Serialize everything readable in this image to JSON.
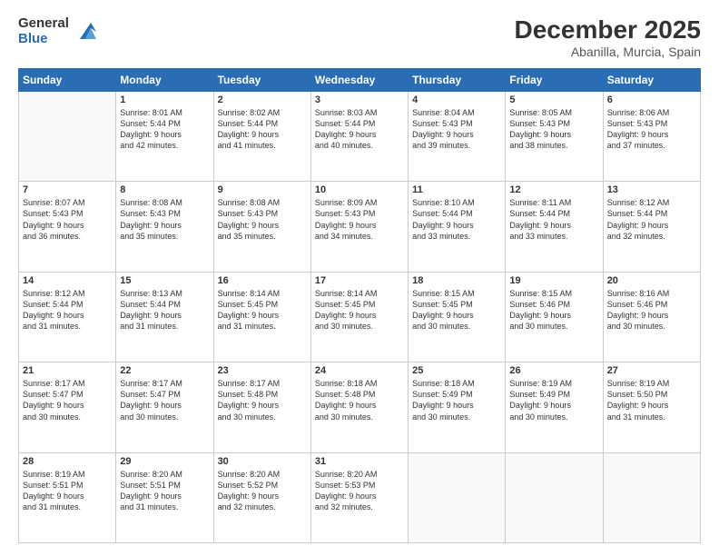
{
  "header": {
    "logo_general": "General",
    "logo_blue": "Blue",
    "month": "December 2025",
    "location": "Abanilla, Murcia, Spain"
  },
  "days_of_week": [
    "Sunday",
    "Monday",
    "Tuesday",
    "Wednesday",
    "Thursday",
    "Friday",
    "Saturday"
  ],
  "weeks": [
    [
      {
        "day": "",
        "info": ""
      },
      {
        "day": "1",
        "info": "Sunrise: 8:01 AM\nSunset: 5:44 PM\nDaylight: 9 hours\nand 42 minutes."
      },
      {
        "day": "2",
        "info": "Sunrise: 8:02 AM\nSunset: 5:44 PM\nDaylight: 9 hours\nand 41 minutes."
      },
      {
        "day": "3",
        "info": "Sunrise: 8:03 AM\nSunset: 5:44 PM\nDaylight: 9 hours\nand 40 minutes."
      },
      {
        "day": "4",
        "info": "Sunrise: 8:04 AM\nSunset: 5:43 PM\nDaylight: 9 hours\nand 39 minutes."
      },
      {
        "day": "5",
        "info": "Sunrise: 8:05 AM\nSunset: 5:43 PM\nDaylight: 9 hours\nand 38 minutes."
      },
      {
        "day": "6",
        "info": "Sunrise: 8:06 AM\nSunset: 5:43 PM\nDaylight: 9 hours\nand 37 minutes."
      }
    ],
    [
      {
        "day": "7",
        "info": "Sunrise: 8:07 AM\nSunset: 5:43 PM\nDaylight: 9 hours\nand 36 minutes."
      },
      {
        "day": "8",
        "info": "Sunrise: 8:08 AM\nSunset: 5:43 PM\nDaylight: 9 hours\nand 35 minutes."
      },
      {
        "day": "9",
        "info": "Sunrise: 8:08 AM\nSunset: 5:43 PM\nDaylight: 9 hours\nand 35 minutes."
      },
      {
        "day": "10",
        "info": "Sunrise: 8:09 AM\nSunset: 5:43 PM\nDaylight: 9 hours\nand 34 minutes."
      },
      {
        "day": "11",
        "info": "Sunrise: 8:10 AM\nSunset: 5:44 PM\nDaylight: 9 hours\nand 33 minutes."
      },
      {
        "day": "12",
        "info": "Sunrise: 8:11 AM\nSunset: 5:44 PM\nDaylight: 9 hours\nand 33 minutes."
      },
      {
        "day": "13",
        "info": "Sunrise: 8:12 AM\nSunset: 5:44 PM\nDaylight: 9 hours\nand 32 minutes."
      }
    ],
    [
      {
        "day": "14",
        "info": "Sunrise: 8:12 AM\nSunset: 5:44 PM\nDaylight: 9 hours\nand 31 minutes."
      },
      {
        "day": "15",
        "info": "Sunrise: 8:13 AM\nSunset: 5:44 PM\nDaylight: 9 hours\nand 31 minutes."
      },
      {
        "day": "16",
        "info": "Sunrise: 8:14 AM\nSunset: 5:45 PM\nDaylight: 9 hours\nand 31 minutes."
      },
      {
        "day": "17",
        "info": "Sunrise: 8:14 AM\nSunset: 5:45 PM\nDaylight: 9 hours\nand 30 minutes."
      },
      {
        "day": "18",
        "info": "Sunrise: 8:15 AM\nSunset: 5:45 PM\nDaylight: 9 hours\nand 30 minutes."
      },
      {
        "day": "19",
        "info": "Sunrise: 8:15 AM\nSunset: 5:46 PM\nDaylight: 9 hours\nand 30 minutes."
      },
      {
        "day": "20",
        "info": "Sunrise: 8:16 AM\nSunset: 5:46 PM\nDaylight: 9 hours\nand 30 minutes."
      }
    ],
    [
      {
        "day": "21",
        "info": "Sunrise: 8:17 AM\nSunset: 5:47 PM\nDaylight: 9 hours\nand 30 minutes."
      },
      {
        "day": "22",
        "info": "Sunrise: 8:17 AM\nSunset: 5:47 PM\nDaylight: 9 hours\nand 30 minutes."
      },
      {
        "day": "23",
        "info": "Sunrise: 8:17 AM\nSunset: 5:48 PM\nDaylight: 9 hours\nand 30 minutes."
      },
      {
        "day": "24",
        "info": "Sunrise: 8:18 AM\nSunset: 5:48 PM\nDaylight: 9 hours\nand 30 minutes."
      },
      {
        "day": "25",
        "info": "Sunrise: 8:18 AM\nSunset: 5:49 PM\nDaylight: 9 hours\nand 30 minutes."
      },
      {
        "day": "26",
        "info": "Sunrise: 8:19 AM\nSunset: 5:49 PM\nDaylight: 9 hours\nand 30 minutes."
      },
      {
        "day": "27",
        "info": "Sunrise: 8:19 AM\nSunset: 5:50 PM\nDaylight: 9 hours\nand 31 minutes."
      }
    ],
    [
      {
        "day": "28",
        "info": "Sunrise: 8:19 AM\nSunset: 5:51 PM\nDaylight: 9 hours\nand 31 minutes."
      },
      {
        "day": "29",
        "info": "Sunrise: 8:20 AM\nSunset: 5:51 PM\nDaylight: 9 hours\nand 31 minutes."
      },
      {
        "day": "30",
        "info": "Sunrise: 8:20 AM\nSunset: 5:52 PM\nDaylight: 9 hours\nand 32 minutes."
      },
      {
        "day": "31",
        "info": "Sunrise: 8:20 AM\nSunset: 5:53 PM\nDaylight: 9 hours\nand 32 minutes."
      },
      {
        "day": "",
        "info": ""
      },
      {
        "day": "",
        "info": ""
      },
      {
        "day": "",
        "info": ""
      }
    ]
  ]
}
